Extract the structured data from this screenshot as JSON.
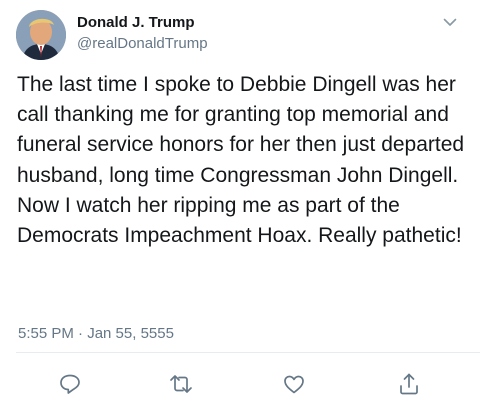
{
  "author": {
    "display_name": "Donald J. Trump",
    "handle": "@realDonaldTrump",
    "avatar_icon": "profile-photo"
  },
  "tweet": {
    "text": "The last time I spoke to Debbie Dingell was her call thanking me for granting top memorial and funeral service honors for her then just departed husband, long time Congressman John Dingell. Now I watch her ripping me as part of the Democrats Impeachment Hoax. Really pathetic!",
    "timestamp": "5:55 PM · Jan 55, 5555"
  },
  "actions": {
    "reply_icon": "reply-icon",
    "retweet_icon": "retweet-icon",
    "like_icon": "like-icon",
    "share_icon": "share-icon"
  },
  "colors": {
    "text": "#14171a",
    "secondary": "#657786",
    "divider": "#e6ecf0"
  }
}
